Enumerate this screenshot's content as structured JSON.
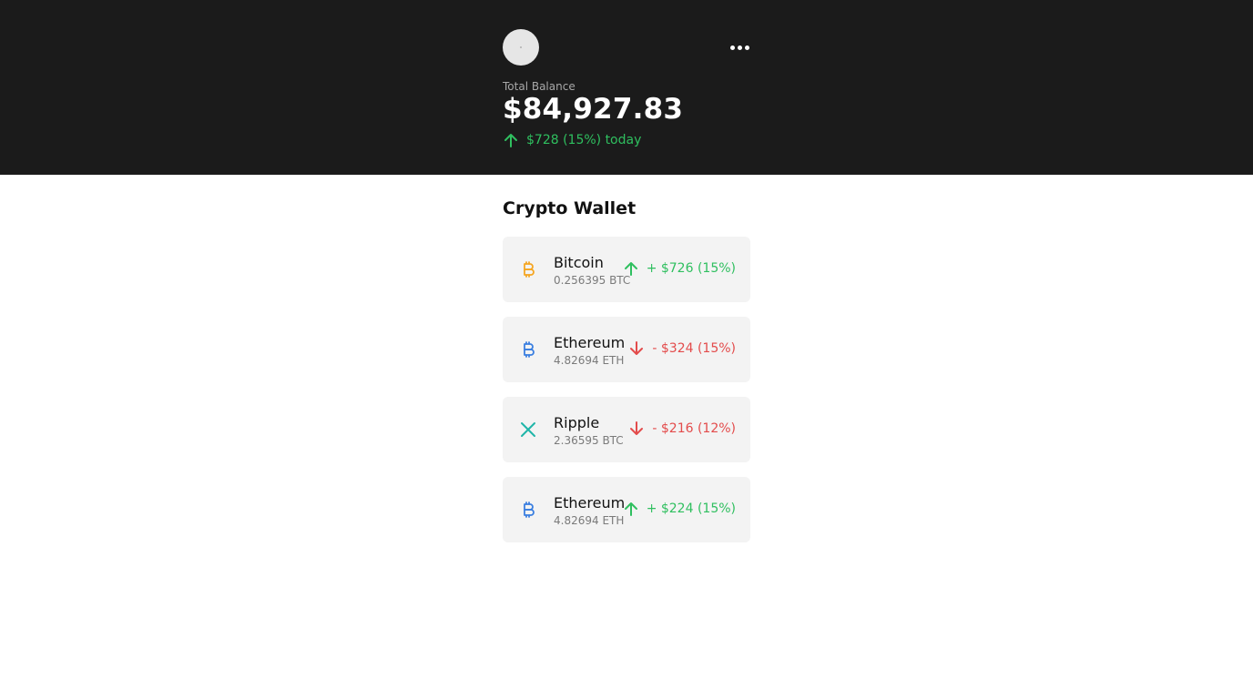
{
  "header": {
    "balance_label": "Total Balance",
    "balance_value": "$84,927.83",
    "today_change": "$728 (15%) today",
    "today_direction": "up"
  },
  "wallet": {
    "title": "Crypto Wallet",
    "items": [
      {
        "name": "Bitcoin",
        "amount": "0.256395 BTC",
        "change": "+ $726 (15%)",
        "direction": "up",
        "icon": "bitcoin-icon",
        "icon_color": "#f5a623"
      },
      {
        "name": "Ethereum",
        "amount": "4.82694 ETH",
        "change": "- $324 (15%)",
        "direction": "down",
        "icon": "bitcoin-icon",
        "icon_color": "#3b7fe0"
      },
      {
        "name": "Ripple",
        "amount": "2.36595 BTC",
        "change": "- $216 (12%)",
        "direction": "down",
        "icon": "ripple-x-icon",
        "icon_color": "#1fb5a8"
      },
      {
        "name": "Ethereum",
        "amount": "4.82694 ETH",
        "change": "+ $224 (15%)",
        "direction": "up",
        "icon": "bitcoin-icon",
        "icon_color": "#3b7fe0"
      }
    ]
  },
  "colors": {
    "header_bg": "#1b1b1b",
    "up": "#2fbf5f",
    "down": "#e34b4b",
    "card_bg": "#f3f3f3"
  }
}
